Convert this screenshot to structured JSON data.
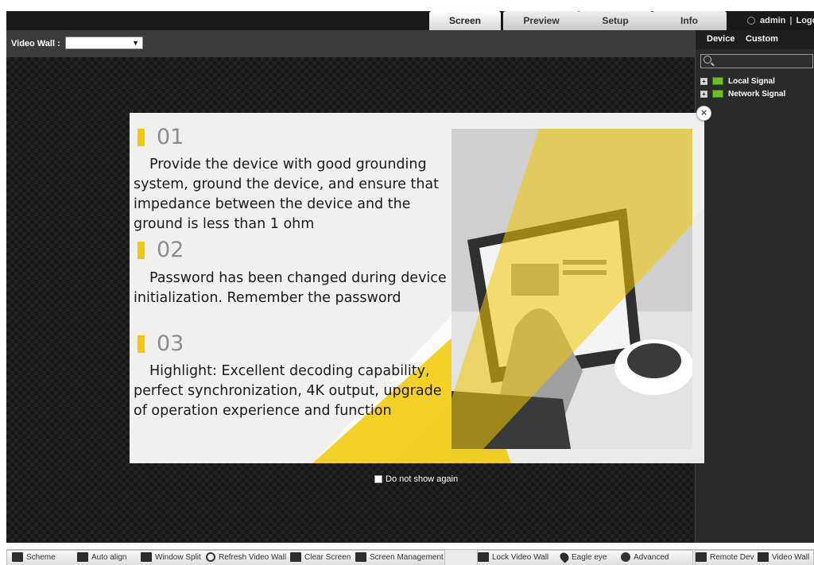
{
  "header": {
    "tabs": [
      {
        "label": "Screen"
      },
      {
        "label": "Preview"
      },
      {
        "label": "Setup"
      },
      {
        "label": "Info"
      }
    ],
    "user": "admin",
    "separator": "|",
    "logout": "Logout"
  },
  "video_wall": {
    "label": "Video Wall :",
    "selected": ""
  },
  "right_panel": {
    "tabs": [
      {
        "label": "Device"
      },
      {
        "label": "Custom"
      }
    ],
    "search_placeholder": "",
    "tree": [
      {
        "expander": "+",
        "label": "Local Signal"
      },
      {
        "expander": "+",
        "label": "Network Signal"
      }
    ]
  },
  "dialog": {
    "steps": [
      {
        "number": "01",
        "text": "Provide the device with good grounding system, ground the device, and ensure that impedance between the device and the ground is less than 1 ohm"
      },
      {
        "number": "02",
        "text": "Password has been changed during device initialization. Remember the password"
      },
      {
        "number": "03",
        "text": "Highlight: Excellent decoding capability, perfect synchronization, 4K output, upgrade of operation experience and function"
      }
    ],
    "close": "×",
    "dont_show_again": "Do not show again",
    "accent_color": "#f2c900"
  },
  "toolbar": {
    "group1": [
      {
        "label": "Scheme",
        "icon": "scheme-icon"
      },
      {
        "label": "Auto align",
        "icon": "auto-align-icon"
      },
      {
        "label": "Window Split",
        "icon": "window-split-icon"
      },
      {
        "label": "Refresh Video Wall",
        "icon": "refresh-icon"
      },
      {
        "label": "Clear Screen",
        "icon": "clear-screen-icon"
      },
      {
        "label": "Screen Management",
        "icon": "monitor-icon"
      }
    ],
    "group2": [
      {
        "label": "Lock Video Wall",
        "icon": "lock-wall-icon"
      },
      {
        "label": "Eagle eye",
        "icon": "location-pin-icon"
      },
      {
        "label": "Advanced",
        "icon": "gear-icon"
      }
    ],
    "group3": [
      {
        "label": "Remote Dev",
        "icon": "remote-device-icon"
      },
      {
        "label": "Video Wall",
        "icon": "video-wall-icon"
      }
    ]
  }
}
